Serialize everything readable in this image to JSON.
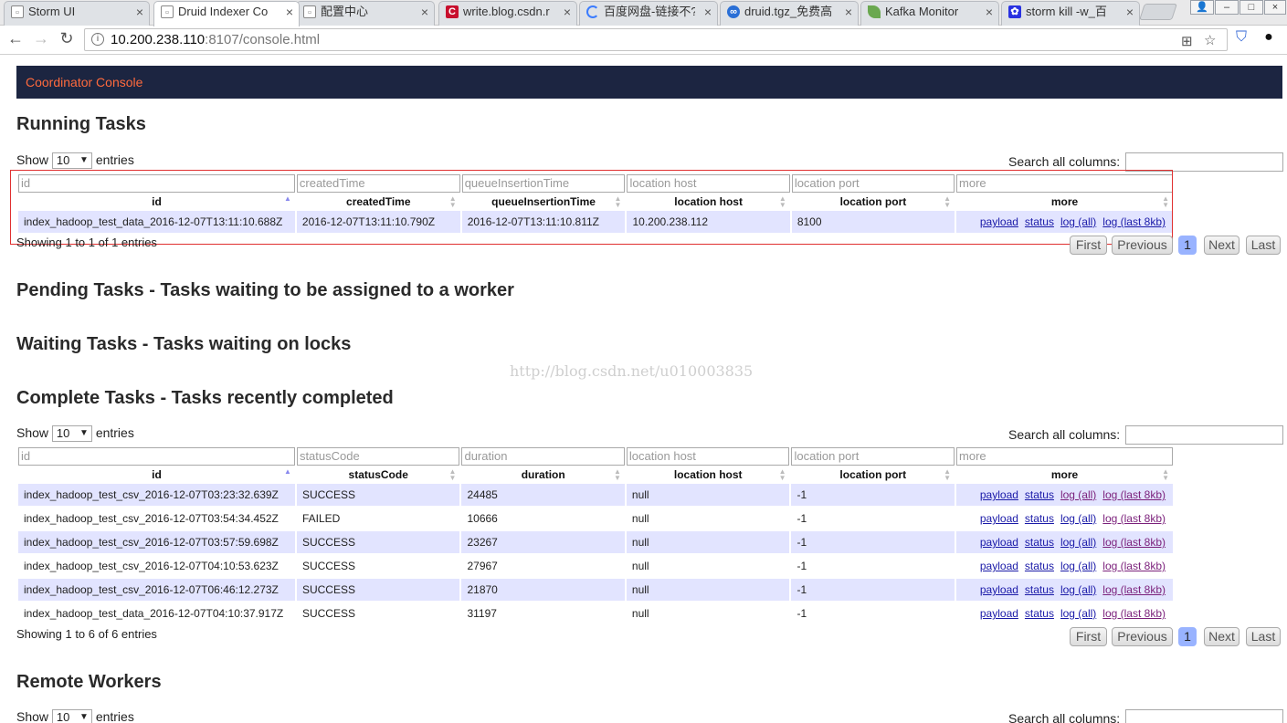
{
  "browser": {
    "tabs": [
      {
        "label": "Storm UI",
        "color": "#888888"
      },
      {
        "label": "Druid Indexer Co",
        "color": "#888888"
      },
      {
        "label": "配置中心",
        "color": "#888888"
      },
      {
        "label": "write.blog.csdn.r",
        "color": "#c8102e"
      },
      {
        "label": "百度网盘-链接不?",
        "color": "#3b7cff"
      },
      {
        "label": "druid.tgz_免费高",
        "color": "#2a6fd6"
      },
      {
        "label": "Kafka Monitor",
        "color": "#6aa84f"
      },
      {
        "label": "storm kill -w_百",
        "color": "#2932e1"
      }
    ],
    "url_host": "10.200.238.110",
    "url_rest": ":8107/console.html"
  },
  "header": {
    "brand": "Coordinator Console"
  },
  "running": {
    "title": "Running Tasks",
    "show": "Show",
    "entries_value": "10",
    "entries": "entries",
    "search_label": "Search all columns:",
    "filters": [
      "id",
      "createdTime",
      "queueInsertionTime",
      "location host",
      "location port",
      "more"
    ],
    "headers": [
      "id",
      "createdTime",
      "queueInsertionTime",
      "location host",
      "location port",
      "more"
    ],
    "rows": [
      {
        "c0": "index_hadoop_test_data_2016-12-07T13:11:10.688Z",
        "c1": "2016-12-07T13:11:10.790Z",
        "c2": "2016-12-07T13:11:10.811Z",
        "c3": "10.200.238.112",
        "c4": "8100"
      }
    ],
    "showing": "Showing 1 to 1 of 1 entries"
  },
  "pending": {
    "title": "Pending Tasks - Tasks waiting to be assigned to a worker"
  },
  "waiting": {
    "title": "Waiting Tasks - Tasks waiting on locks"
  },
  "watermark": "http://blog.csdn.net/u010003835",
  "complete": {
    "title": "Complete Tasks - Tasks recently completed",
    "show": "Show",
    "entries_value": "10",
    "entries": "entries",
    "search_label": "Search all columns:",
    "filters": [
      "id",
      "statusCode",
      "duration",
      "location host",
      "location port",
      "more"
    ],
    "headers": [
      "id",
      "statusCode",
      "duration",
      "location host",
      "location port",
      "more"
    ],
    "rows": [
      {
        "c0": "index_hadoop_test_csv_2016-12-07T03:23:32.639Z",
        "c1": "SUCCESS",
        "c2": "24485",
        "c3": "null",
        "c4": "-1"
      },
      {
        "c0": "index_hadoop_test_csv_2016-12-07T03:54:34.452Z",
        "c1": "FAILED",
        "c2": "10666",
        "c3": "null",
        "c4": "-1"
      },
      {
        "c0": "index_hadoop_test_csv_2016-12-07T03:57:59.698Z",
        "c1": "SUCCESS",
        "c2": "23267",
        "c3": "null",
        "c4": "-1"
      },
      {
        "c0": "index_hadoop_test_csv_2016-12-07T04:10:53.623Z",
        "c1": "SUCCESS",
        "c2": "27967",
        "c3": "null",
        "c4": "-1"
      },
      {
        "c0": "index_hadoop_test_csv_2016-12-07T06:46:12.273Z",
        "c1": "SUCCESS",
        "c2": "21870",
        "c3": "null",
        "c4": "-1"
      },
      {
        "c0": "index_hadoop_test_data_2016-12-07T04:10:37.917Z",
        "c1": "SUCCESS",
        "c2": "31197",
        "c3": "null",
        "c4": "-1"
      }
    ],
    "showing": "Showing 1 to 6 of 6 entries"
  },
  "links": {
    "payload": "payload",
    "status": "status",
    "log_all": "log (all)",
    "log_last": "log (last 8kb)"
  },
  "pager": {
    "first": "First",
    "previous": "Previous",
    "page": "1",
    "next": "Next",
    "last": "Last"
  },
  "remote": {
    "title": "Remote Workers",
    "show": "Show",
    "entries_value": "10",
    "entries": "entries",
    "search_label": "Search all columns:"
  }
}
